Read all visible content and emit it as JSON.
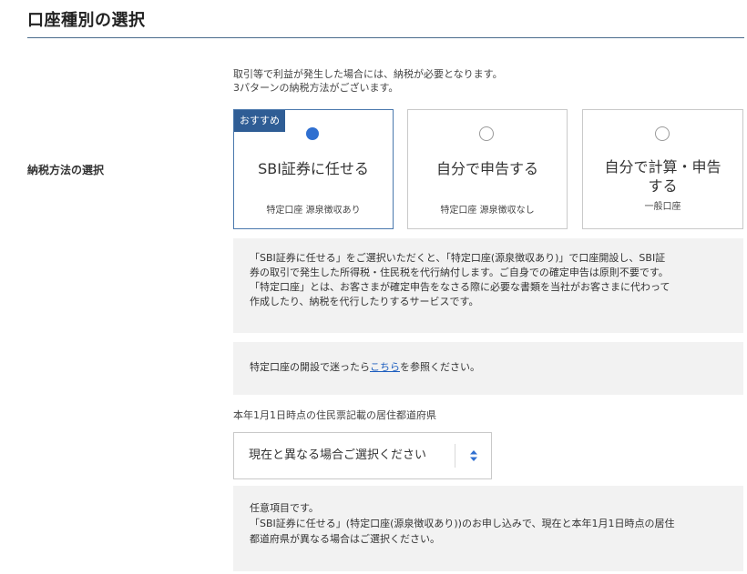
{
  "page": {
    "title": "口座種別の選択"
  },
  "tax_method": {
    "label": "納税方法の選択",
    "intro_lines": [
      "取引等で利益が発生した場合には、納税が必要となります。",
      "3パターンの納税方法がございます。"
    ],
    "options": [
      {
        "badge": "おすすめ",
        "title": "SBI証券に任せる",
        "subtitle": "特定口座 源泉徴収あり",
        "selected": true
      },
      {
        "title": "自分で申告する",
        "subtitle": "特定口座 源泉徴収なし",
        "selected": false
      },
      {
        "title_line1": "自分で計算・申告",
        "title_line2": "する",
        "subtitle": "一般口座",
        "selected": false
      }
    ],
    "description_lines": [
      "「SBI証券に任せる」をご選択いただくと、「特定口座(源泉徴収あり)」で口座開設し、SBI証",
      "券の取引で発生した所得税・住民税を代行納付します。ご自身での確定申告は原則不要です。",
      "「特定口座」とは、お客さまが確定申告をなさる際に必要な書類を当社がお客さまに代わって",
      "作成したり、納税を代行したりするサービスです。"
    ],
    "help": {
      "before": "特定口座の開設で迷ったら",
      "link": "こちら",
      "after": "を参照ください。"
    }
  },
  "residence": {
    "label": "本年1月1日時点の住民票記載の居住都道府県",
    "select_value": "現在と異なる場合ご選択ください",
    "note_lines": [
      "任意項目です。",
      "「SBI証券に任せる」(特定口座(源泉徴収あり))のお申し込みで、現在と本年1月1日時点の居住",
      "都道府県が異なる場合はご選択ください。"
    ]
  },
  "colors": {
    "accent": "#2f5d95",
    "radio_checked": "#2f6fd0",
    "link": "#1f5fbf",
    "info_bg": "#f2f2f2"
  }
}
